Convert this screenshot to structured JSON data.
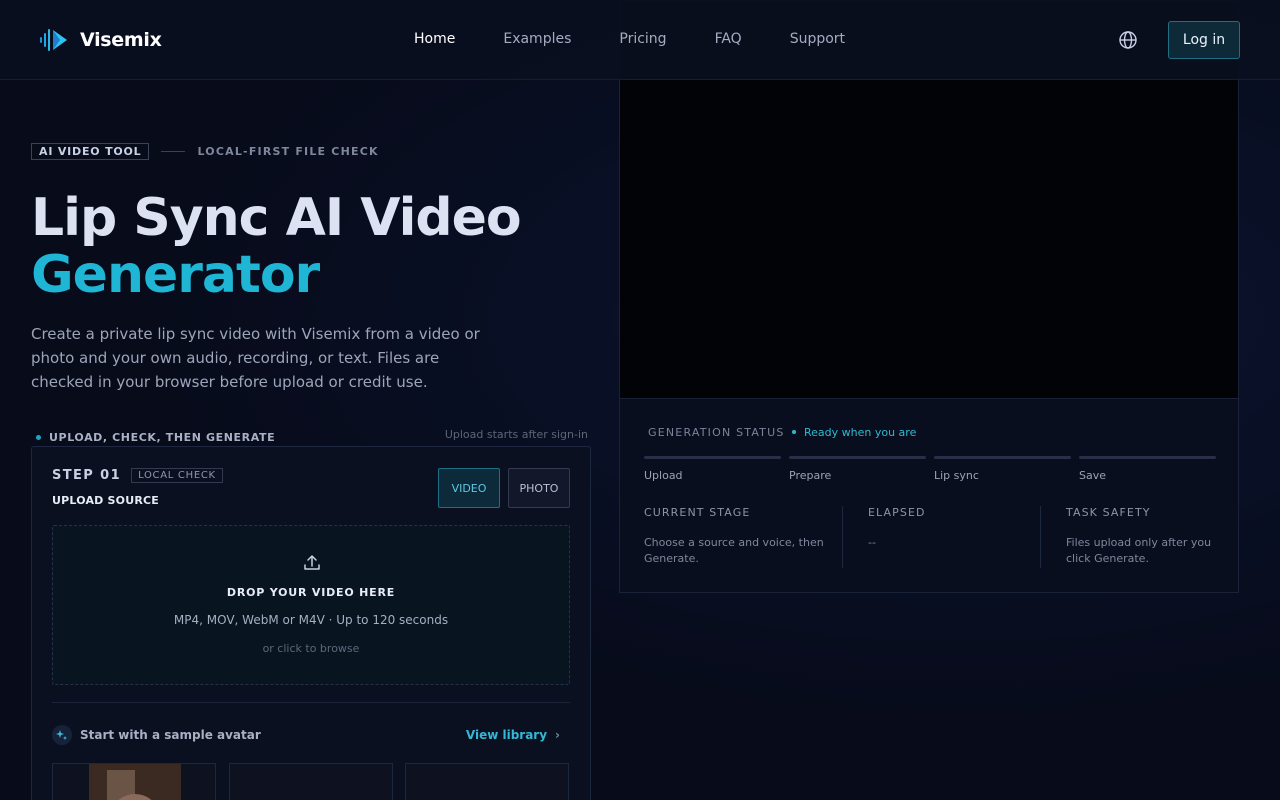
{
  "header": {
    "brand": "Visemix",
    "nav": [
      "Home",
      "Examples",
      "Pricing",
      "FAQ",
      "Support"
    ],
    "active_nav": "Home",
    "login": "Log in"
  },
  "hero": {
    "tag": "AI VIDEO TOOL",
    "tag2": "LOCAL-FIRST FILE CHECK",
    "title_line1": "Lip Sync AI Video",
    "title_line2": "Generator",
    "description": "Create a private lip sync video with Visemix from a video or photo and your own audio, recording, or text. Files are checked in your browser before upload or credit use."
  },
  "flow": {
    "label": "UPLOAD, CHECK, THEN GENERATE",
    "note": "Upload starts after sign-in"
  },
  "upload": {
    "step": "STEP 01",
    "step_tag": "LOCAL CHECK",
    "source_label": "UPLOAD SOURCE",
    "modes": [
      "VIDEO",
      "PHOTO"
    ],
    "active_mode": "VIDEO",
    "drop_title": "DROP YOUR VIDEO HERE",
    "formats": "MP4, MOV, WebM or M4V · Up to 120 seconds",
    "browse": "or click to browse",
    "sample_label": "Start with a sample avatar",
    "view_library": "View library"
  },
  "status": {
    "label": "GENERATION STATUS",
    "ready": "Ready when you are",
    "steps": [
      "Upload",
      "Prepare",
      "Lip sync",
      "Save"
    ],
    "current_stage_label": "CURRENT STAGE",
    "current_stage_text": "Choose a source and voice, then Generate.",
    "elapsed_label": "ELAPSED",
    "elapsed_value": "--",
    "safety_label": "TASK SAFETY",
    "safety_text": "Files upload only after you click Generate."
  },
  "colors": {
    "accent": "#1fb6d6",
    "background": "#070b1a",
    "panel": "#0b1020"
  }
}
